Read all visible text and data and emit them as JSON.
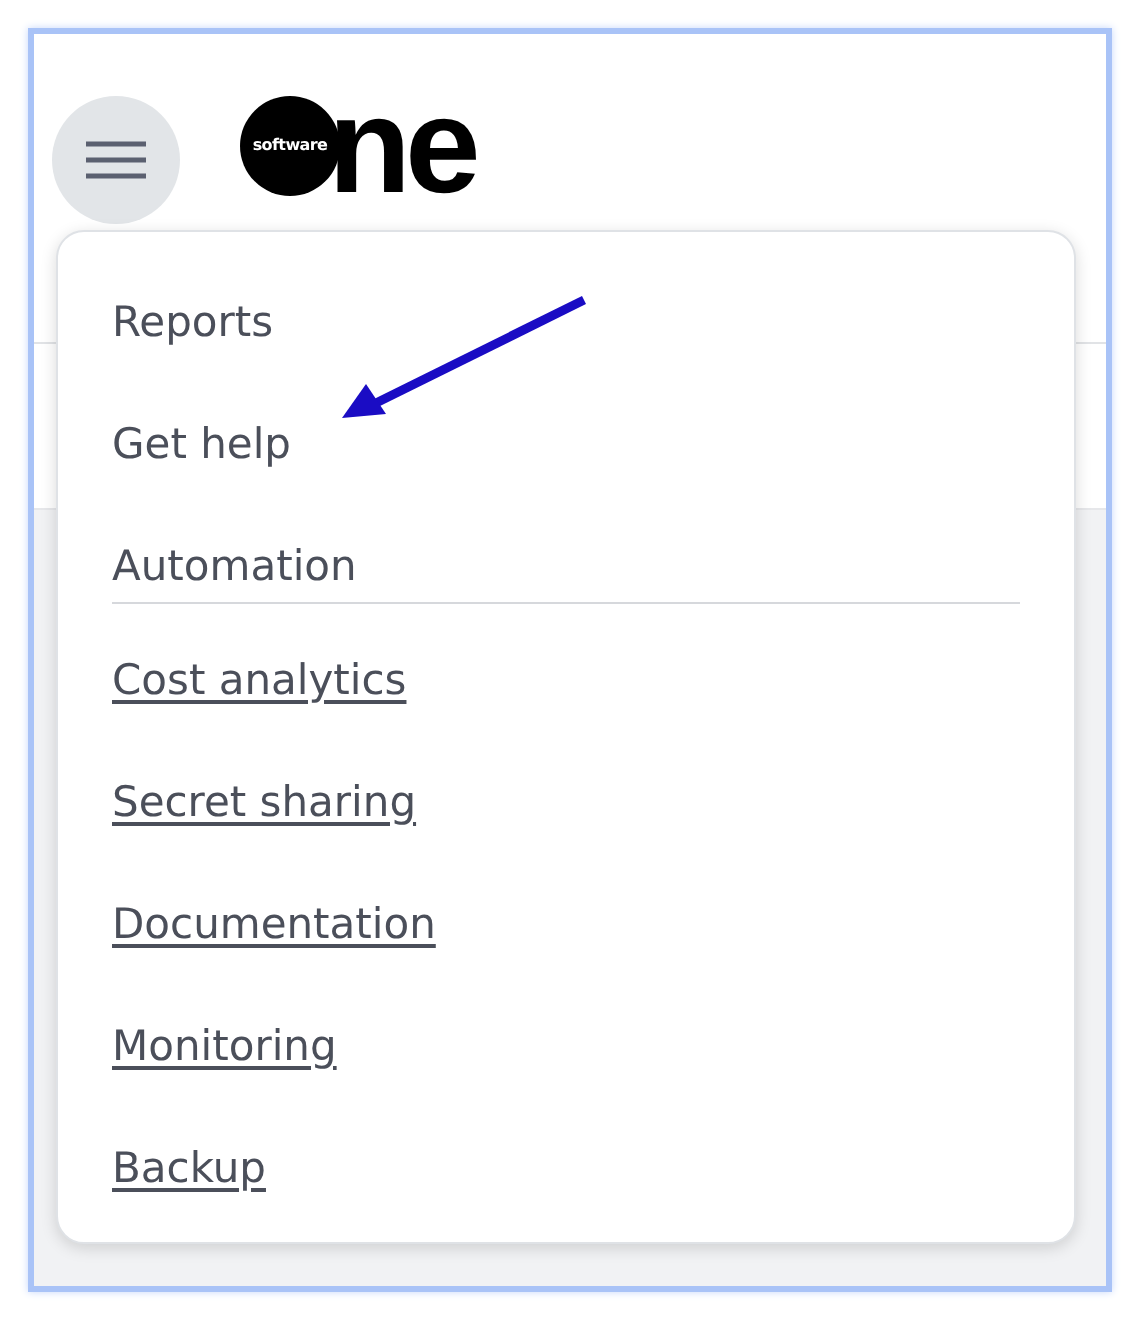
{
  "logo": {
    "small_text": "software",
    "large_text": "ne"
  },
  "menu": {
    "sections": [
      {
        "items": [
          {
            "label": "Reports",
            "kind": "item"
          },
          {
            "label": "Get help",
            "kind": "item"
          },
          {
            "label": "Automation",
            "kind": "item"
          }
        ]
      },
      {
        "items": [
          {
            "label": "Cost analytics",
            "kind": "link"
          },
          {
            "label": "Secret sharing",
            "kind": "link"
          },
          {
            "label": "Documentation",
            "kind": "link"
          },
          {
            "label": "Monitoring",
            "kind": "link"
          },
          {
            "label": "Backup",
            "kind": "link"
          }
        ]
      }
    ]
  }
}
